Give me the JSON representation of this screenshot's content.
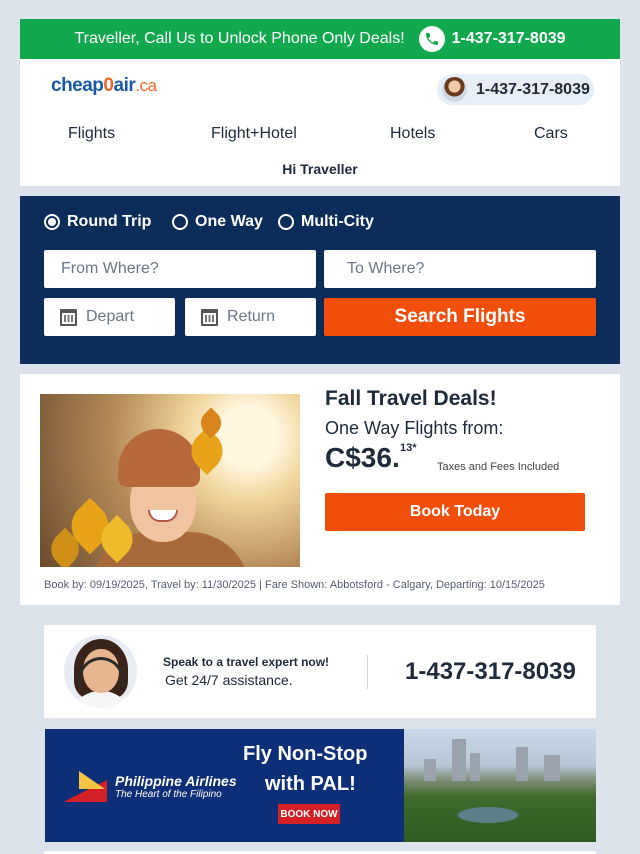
{
  "top_bar": {
    "message": "Traveller, Call Us to Unlock Phone Only Deals!",
    "phone": "1-437-317-8039",
    "bg_color": "#12a94e"
  },
  "header": {
    "logo": {
      "part1": "cheap",
      "part2": "0",
      "part3": "air",
      "part4": ".ca"
    },
    "phone": "1-437-317-8039",
    "nav": [
      "Flights",
      "Flight+Hotel",
      "Hotels",
      "Cars"
    ],
    "greeting": "Hi Traveller"
  },
  "search": {
    "trip_types": [
      "Round Trip",
      "One Way",
      "Multi-City"
    ],
    "selected_trip": "Round Trip",
    "from_placeholder": "From Where?",
    "to_placeholder": "To Where?",
    "depart_placeholder": "Depart",
    "return_placeholder": "Return",
    "search_label": "Search Flights",
    "bg_color": "#0c2d5a",
    "button_color": "#f04e0a"
  },
  "deal": {
    "title": "Fall Travel Deals!",
    "subtitle": "One Way Flights from:",
    "price": "C$36.",
    "cents": "13*",
    "taxes_note": "Taxes and Fees Included",
    "button_label": "Book Today",
    "fine_print": "Book by: 09/19/2025, Travel by: 11/30/2025  | Fare Shown: Abbotsford - Calgary, Departing: 10/15/2025"
  },
  "expert": {
    "line1": "Speak to a travel expert now!",
    "line2": "Get 24/7 assistance.",
    "phone": "1-437-317-8039"
  },
  "banner": {
    "airline": "Philippine Airlines",
    "tagline": "The Heart of the Filipino",
    "headline1": "Fly Non-Stop",
    "headline2": "with PAL!",
    "cta": "BOOK NOW"
  },
  "icons": {
    "phone": "phone-icon",
    "calendar": "calendar-icon",
    "radio": "radio-icon"
  }
}
